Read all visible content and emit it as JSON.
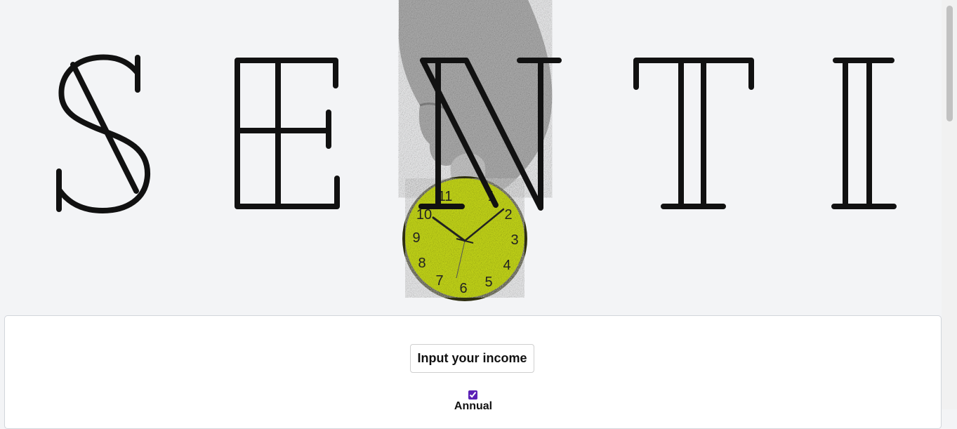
{
  "hero": {
    "letters": [
      "S",
      "E",
      "N",
      "T",
      "I"
    ],
    "clock_numbers": [
      "11",
      "1",
      "2",
      "3",
      "4",
      "5",
      "6",
      "7",
      "8",
      "9",
      "10"
    ],
    "clock_color": "#cde01a",
    "ink_color": "#111111"
  },
  "income": {
    "button_label": "Input your income",
    "annual_label": "Annual",
    "annual_checked": true
  },
  "colors": {
    "page_bg": "#f3f4f6",
    "accent": "#5b21b6"
  }
}
